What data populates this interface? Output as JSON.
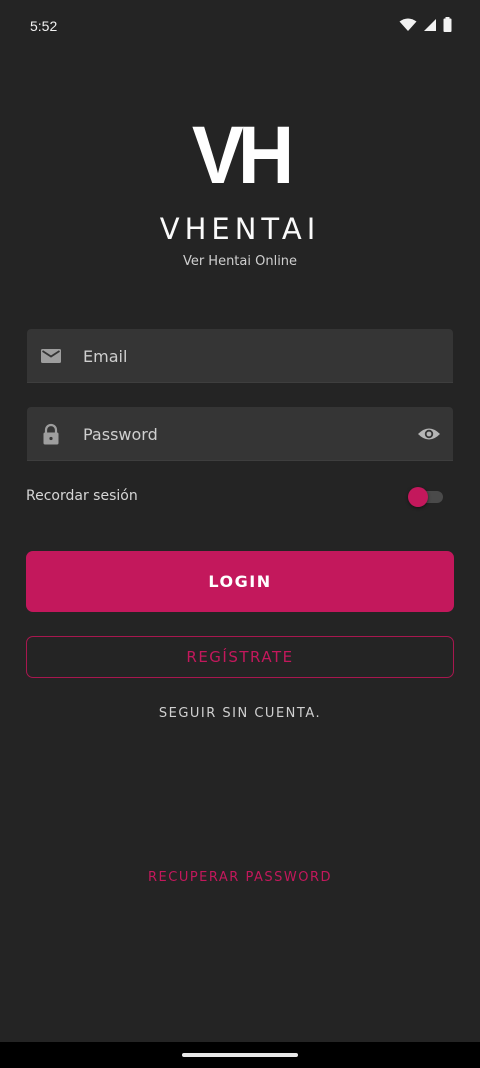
{
  "status": {
    "time": "5:52"
  },
  "brand": {
    "logo_text": "VH",
    "name": "VHENTAI",
    "tagline": "Ver Hentai Online"
  },
  "form": {
    "email_placeholder": "Email",
    "password_placeholder": "Password",
    "remember_label": "Recordar sesión",
    "remember_on": true
  },
  "actions": {
    "login": "LOGIN",
    "register": "REGÍSTRATE",
    "guest": "SEGUIR SIN CUENTA.",
    "recover": "RECUPERAR PASSWORD"
  },
  "colors": {
    "accent": "#c3185c",
    "background": "#242424",
    "field": "#353535"
  },
  "icons": {
    "email": "mail-icon",
    "password": "lock-icon",
    "password_toggle": "eye-icon",
    "wifi": "wifi-icon",
    "signal": "signal-icon",
    "battery": "battery-icon"
  }
}
